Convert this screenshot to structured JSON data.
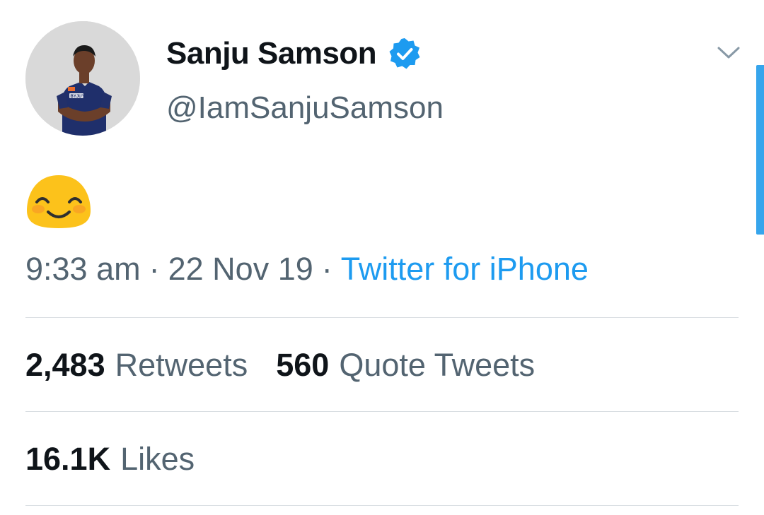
{
  "user": {
    "display_name": "Sanju Samson",
    "handle": "@IamSanjuSamson",
    "verified": true,
    "avatar_jersey_text": "BYJU'S"
  },
  "tweet": {
    "content_emoji": "smiling-face-with-smiling-eyes"
  },
  "meta": {
    "time": "9:33 am",
    "sep1": "·",
    "date": "22 Nov 19",
    "sep2": "·",
    "source": "Twitter for iPhone"
  },
  "stats": {
    "retweets_count": "2,483",
    "retweets_label": "Retweets",
    "quotes_count": "560",
    "quotes_label": "Quote Tweets",
    "likes_count": "16.1K",
    "likes_label": "Likes"
  },
  "colors": {
    "accent": "#1d9bf0",
    "secondary_text": "#536471",
    "primary_text": "#0f1419",
    "scrollbar": "#36a5ec"
  }
}
